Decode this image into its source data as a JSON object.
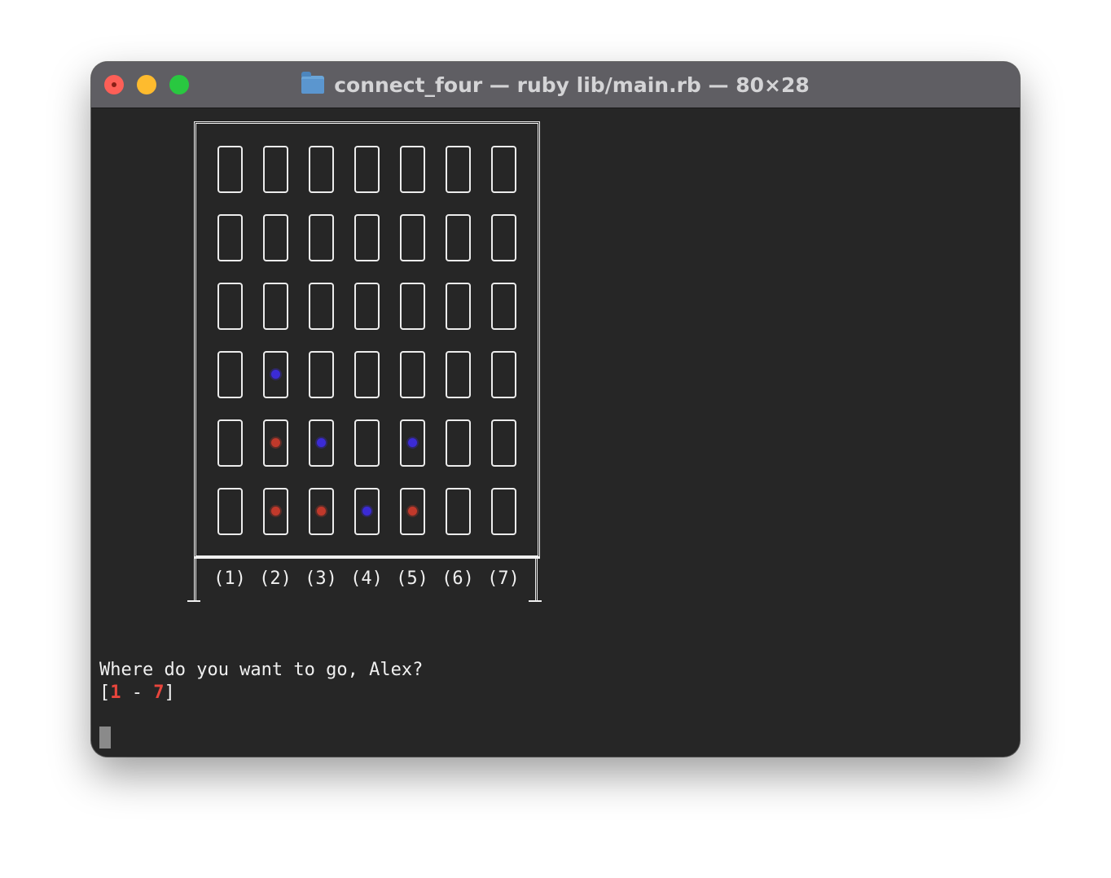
{
  "window": {
    "title": "connect_four — ruby lib/main.rb — 80×28",
    "title_icon": "folder-icon"
  },
  "board": {
    "columns": 7,
    "rows": 6,
    "column_labels": [
      "(1)",
      "(2)",
      "(3)",
      "(4)",
      "(5)",
      "(6)",
      "(7)"
    ],
    "grid": [
      [
        "",
        "",
        "",
        "",
        "",
        "",
        ""
      ],
      [
        "",
        "",
        "",
        "",
        "",
        "",
        ""
      ],
      [
        "",
        "",
        "",
        "",
        "",
        "",
        ""
      ],
      [
        "",
        "blue",
        "",
        "",
        "",
        "",
        ""
      ],
      [
        "",
        "red",
        "blue",
        "",
        "blue",
        "",
        ""
      ],
      [
        "",
        "red",
        "red",
        "blue",
        "red",
        "",
        ""
      ]
    ],
    "colors": {
      "red": "#c0392b",
      "blue": "#3b2bd6",
      "border": "#f0f0f0"
    }
  },
  "prompt": {
    "question": "Where do you want to go, Alex?",
    "range_open": "[",
    "range_min": "1",
    "range_sep": " - ",
    "range_max": "7",
    "range_close": "]"
  },
  "theme": {
    "terminal_bg": "#262626",
    "titlebar_bg": "#5f5e63",
    "highlight": "#e8453c"
  }
}
